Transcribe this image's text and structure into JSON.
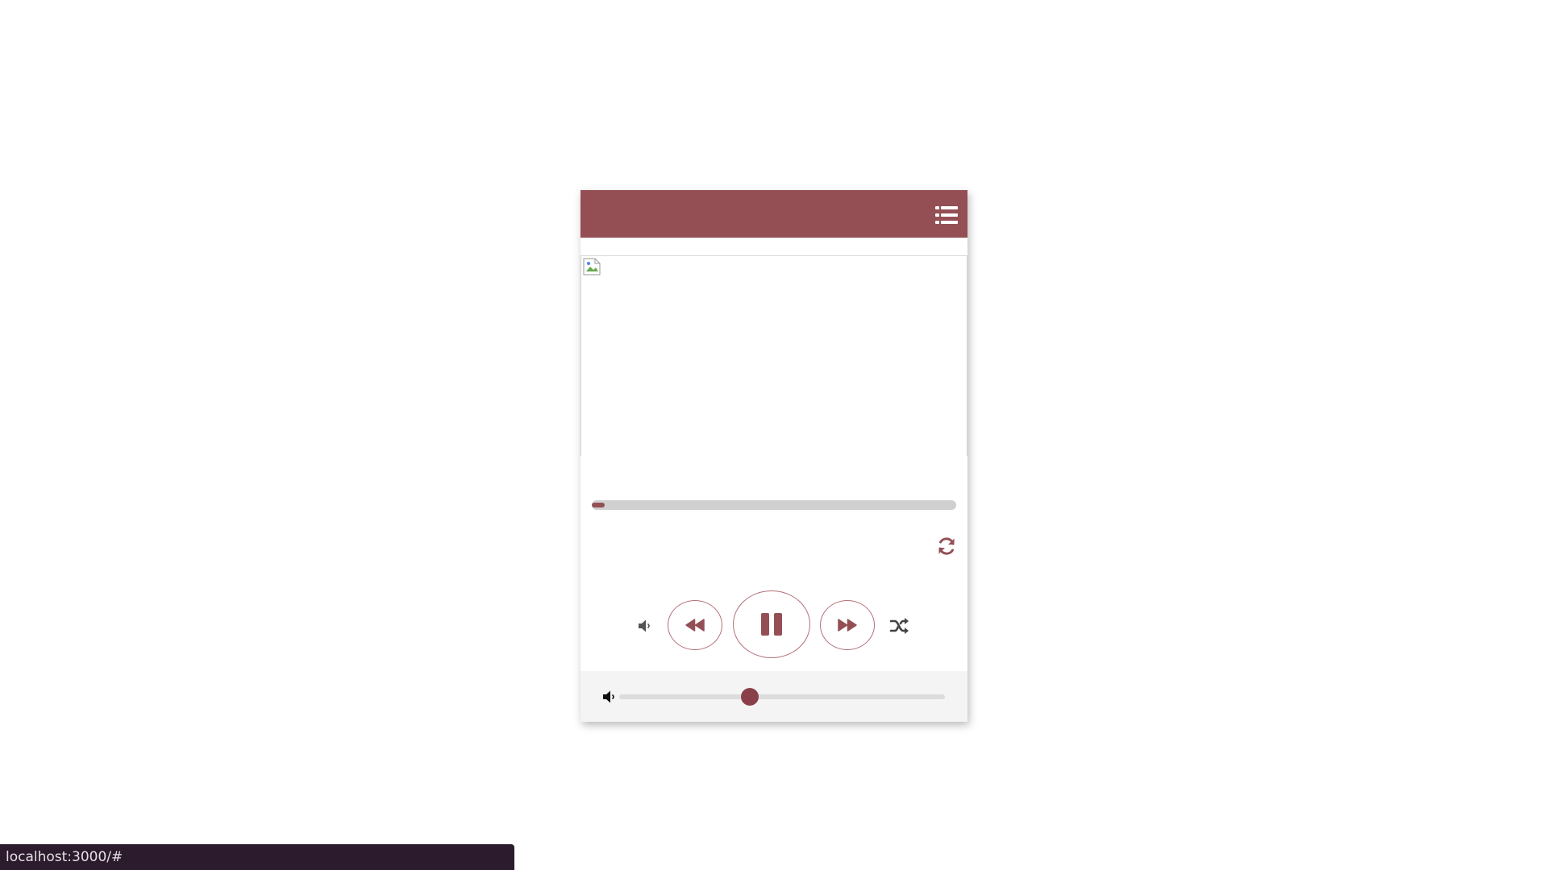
{
  "colors": {
    "accent": "#944f55",
    "button_border": "#b47078",
    "volume_thumb": "#8a4049",
    "status_bar_bg": "#2b1b2c"
  },
  "header": {
    "menu_icon": "list-icon"
  },
  "artwork": {
    "icon": "broken-image-icon"
  },
  "playback": {
    "progress_fraction": 0.03
  },
  "controls": {
    "repeat_icon": "repeat-icon",
    "mute_icon": "speaker-icon",
    "prev_icon": "backward-icon",
    "pause_icon": "pause-icon",
    "next_icon": "forward-icon",
    "shuffle_icon": "shuffle-icon"
  },
  "volume": {
    "icon": "volume-low-icon",
    "level_fraction": 0.4
  },
  "status_bar": {
    "url": "localhost:3000/#"
  }
}
